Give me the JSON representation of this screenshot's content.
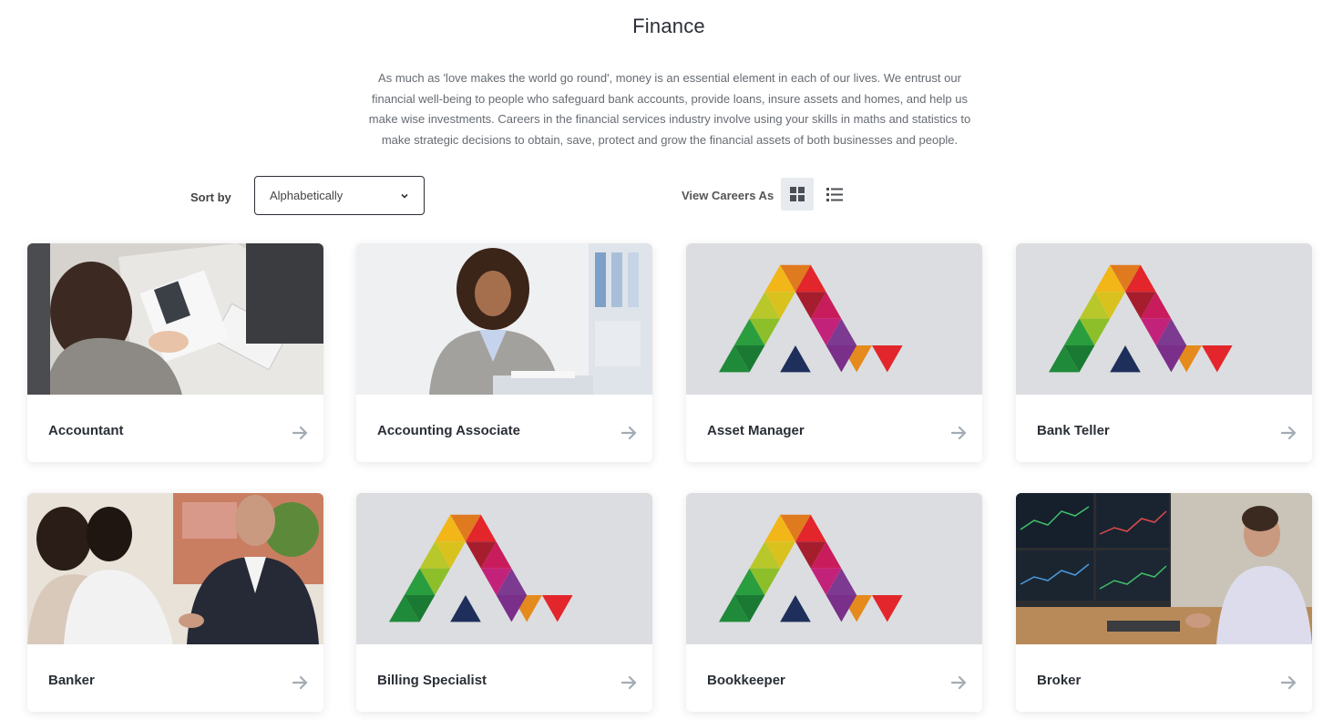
{
  "page": {
    "title": "Finance",
    "intro": "As much as 'love makes the world go round', money is an essential element in each of our lives. We entrust our financial well-being to people who safeguard bank accounts, provide loans, insure assets and homes, and help us make wise investments. Careers in the financial services industry involve using your skills in maths and statistics to make strategic decisions to obtain, save, protect and grow the financial assets of both businesses and people."
  },
  "controls": {
    "sort_label": "Sort by",
    "sort_value": "Alphabetically",
    "view_label": "View Careers As",
    "view_options": [
      "grid-view-icon",
      "list-view-icon"
    ],
    "selected_view": "grid"
  },
  "careers": [
    {
      "name": "Accountant",
      "image": "photo-accountant"
    },
    {
      "name": "Accounting Associate",
      "image": "photo-accounting-associate"
    },
    {
      "name": "Asset Manager",
      "image": "logo-placeholder"
    },
    {
      "name": "Bank Teller",
      "image": "logo-placeholder"
    },
    {
      "name": "Banker",
      "image": "photo-banker"
    },
    {
      "name": "Billing Specialist",
      "image": "logo-placeholder"
    },
    {
      "name": "Bookkeeper",
      "image": "logo-placeholder"
    },
    {
      "name": "Broker",
      "image": "photo-broker"
    }
  ],
  "colors": {
    "placeholder_bg": "#dcdde0",
    "arrow": "#a3acb4",
    "active_view_bg": "#e7ebef",
    "title": "#2a2f36"
  }
}
